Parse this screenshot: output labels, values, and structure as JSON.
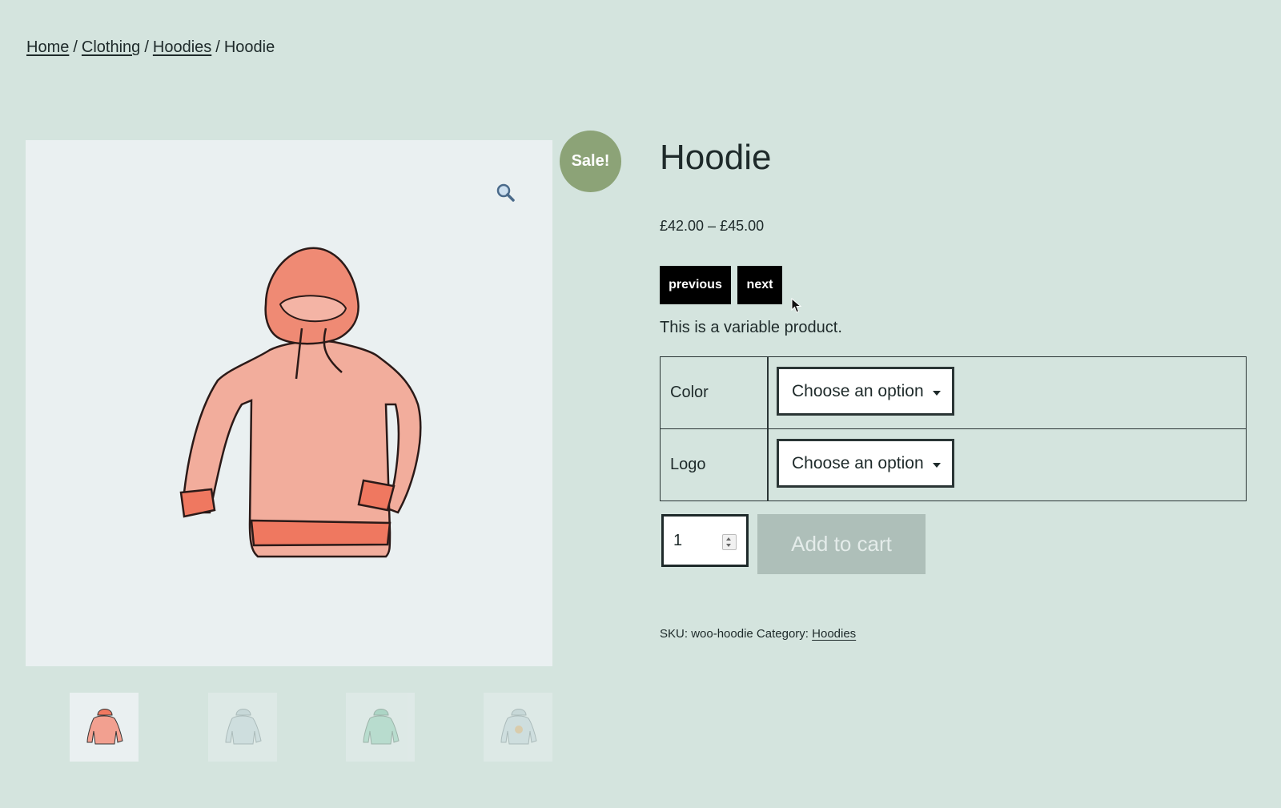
{
  "breadcrumb": {
    "home": "Home",
    "clothing": "Clothing",
    "hoodies": "Hoodies",
    "current": "Hoodie",
    "separator": "/"
  },
  "gallery": {
    "zoom_icon": "magnifier-icon",
    "sale_badge": "Sale!",
    "thumbnails": [
      "hoodie-red",
      "hoodie-blue",
      "hoodie-green",
      "hoodie-logo"
    ]
  },
  "product": {
    "title": "Hoodie",
    "price": "£42.00 – £45.00",
    "previous_label": "previous",
    "next_label": "next",
    "description": "This is a variable product.",
    "variations": [
      {
        "label": "Color",
        "selected": "Choose an option"
      },
      {
        "label": "Logo",
        "selected": "Choose an option"
      }
    ],
    "quantity": "1",
    "add_to_cart_label": "Add to cart",
    "sku_label": "SKU:",
    "sku_value": "woo-hoodie",
    "category_label": "Category:",
    "category_value": "Hoodies"
  },
  "colors": {
    "background": "#d4e4de",
    "sale_badge": "#8ca377",
    "button_dark": "#000000",
    "add_to_cart_disabled": "#aebfb9"
  }
}
